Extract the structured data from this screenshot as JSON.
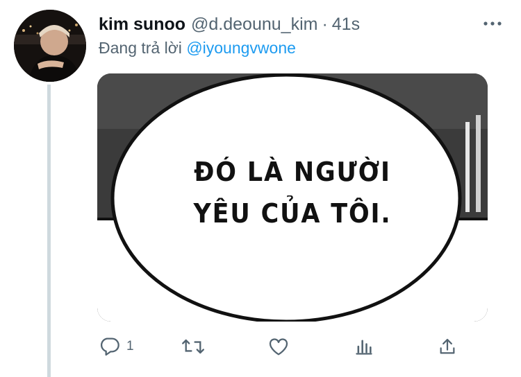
{
  "tweet": {
    "display_name": "kim sunoo",
    "handle": "@d.deounu_kim",
    "separator": "·",
    "time": "41s",
    "reply_prefix": "Đang trả lời",
    "reply_to": "@iyoungvwone",
    "image_text_line1": "ĐÓ LÀ NGƯỜI",
    "image_text_line2": "YÊU CỦA TÔI.",
    "reply_count": "1"
  },
  "icons": [
    "more-icon",
    "reply-icon",
    "retweet-icon",
    "like-icon",
    "stats-icon",
    "share-icon"
  ],
  "colors": {
    "accent": "#1d9bf0",
    "secondary_text": "#536471",
    "thread_line": "#cfd9de"
  }
}
